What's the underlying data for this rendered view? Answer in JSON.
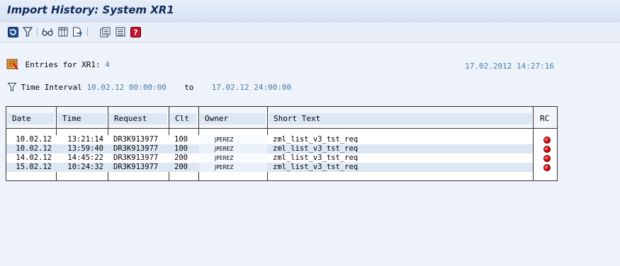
{
  "window": {
    "title": "Import History: System XR1"
  },
  "toolbar": {
    "buttons": [
      {
        "icon": "refresh-icon"
      },
      {
        "icon": "filter-icon"
      },
      {
        "icon": "glasses-icon"
      },
      {
        "icon": "columns-icon"
      },
      {
        "icon": "export-icon"
      },
      {
        "icon": "details-icon"
      },
      {
        "icon": "list-icon"
      },
      {
        "icon": "help-icon"
      }
    ]
  },
  "summary": {
    "entries_label": "Entries for XR1:",
    "entries_count": "4",
    "timestamp": "17.02.2012 14:27:16",
    "interval_label": "Time Interval",
    "interval_from": "10.02.12 00:00:00",
    "to_label": "to",
    "interval_to": "17.02.12 24:00:00"
  },
  "table": {
    "columns": [
      "Date",
      "Time",
      "Request",
      "Clt",
      "Owner",
      "Short Text",
      "RC"
    ],
    "rows": [
      {
        "date": "10.02.12",
        "time": "13:21:14",
        "request": "DR3K913977",
        "clt": "100",
        "owner": "JPEREZ",
        "text": "zml_list_v3_tst_req",
        "rc": "error"
      },
      {
        "date": "10.02.12",
        "time": "13:59:40",
        "request": "DR3K913977",
        "clt": "100",
        "owner": "JPEREZ",
        "text": "zml_list_v3_tst_req",
        "rc": "error"
      },
      {
        "date": "14.02.12",
        "time": "14:45:22",
        "request": "DR3K913977",
        "clt": "200",
        "owner": "JPEREZ",
        "text": "zml_list_v3_tst_req",
        "rc": "error"
      },
      {
        "date": "15.02.12",
        "time": "10:24:32",
        "request": "DR3K913977",
        "clt": "200",
        "owner": "JPEREZ",
        "text": "zml_list_v3_tst_req",
        "rc": "error"
      }
    ]
  },
  "colors": {
    "value_text": "#4b7aa7",
    "title_text": "#102a5c",
    "error_light": "#e00000"
  }
}
